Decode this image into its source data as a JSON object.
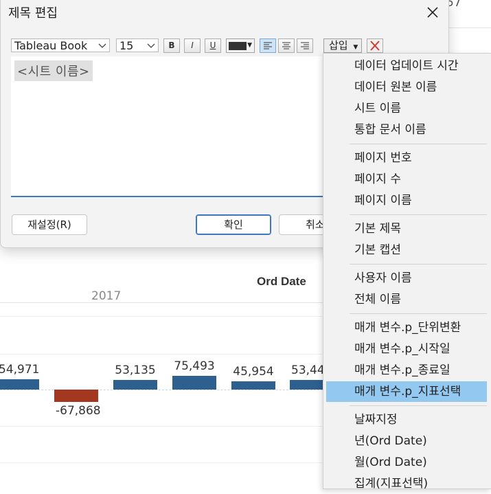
{
  "worksheet": {
    "corner_number": "57",
    "axis_title": "Ord Date",
    "year_label": "2017",
    "bars": [
      {
        "label": "54,971",
        "value": 54971,
        "color": "#2d5f8f"
      },
      {
        "label": "-67,868",
        "value": -67868,
        "color": "#a3381e"
      },
      {
        "label": "53,135",
        "value": 53135,
        "color": "#2d5f8f"
      },
      {
        "label": "75,493",
        "value": 75493,
        "color": "#2d5f8f"
      },
      {
        "label": "45,954",
        "value": 45954,
        "color": "#2d5f8f"
      },
      {
        "label": "53,44",
        "value": 53440,
        "color": "#2d5f8f"
      }
    ]
  },
  "dialog": {
    "title": "제목 편집",
    "font_name": "Tableau Book",
    "font_size": "15",
    "bold_label": "B",
    "italic_label": "I",
    "underline_label": "U",
    "text_color": "#333333",
    "insert_label": "삽입",
    "editor_token": "<시트 이름>",
    "reset_label": "재설정(R)",
    "ok_label": "확인",
    "cancel_label": "취소"
  },
  "menu": {
    "groups": [
      [
        "데이터 업데이트 시간",
        "데이터 원본 이름",
        "시트 이름",
        "통합 문서 이름"
      ],
      [
        "페이지 번호",
        "페이지 수",
        "페이지 이름"
      ],
      [
        "기본 제목",
        "기본 캡션"
      ],
      [
        "사용자 이름",
        "전체 이름"
      ],
      [
        "매개 변수.p_단위변환",
        "매개 변수.p_시작일",
        "매개 변수.p_종료일",
        "매개 변수.p_지표선택"
      ],
      [
        "날짜지정",
        "년(Ord Date)",
        "월(Ord Date)",
        "집계(지표선택)"
      ]
    ],
    "highlighted": "매개 변수.p_지표선택"
  },
  "colors": {
    "accent": "#3b78c2",
    "menu_highlight": "#93c8f1",
    "positive_bar": "#2d5f8f",
    "negative_bar": "#a3381e"
  }
}
